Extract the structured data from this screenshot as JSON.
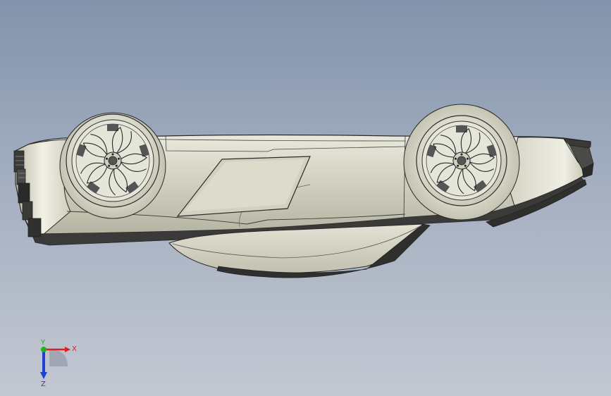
{
  "viewport": {
    "background_top": "#8293ab",
    "background_bottom": "#c3c8d2"
  },
  "model": {
    "body_color": "#d7d6c7",
    "edge_color": "#2a2a2a",
    "dark_trim_color": "#3a3a38"
  },
  "triad": {
    "x_label": "X",
    "y_label": "Y",
    "z_label": "Z",
    "x_color": "#e02020",
    "y_color": "#20b020",
    "z_color": "#2040d0"
  }
}
